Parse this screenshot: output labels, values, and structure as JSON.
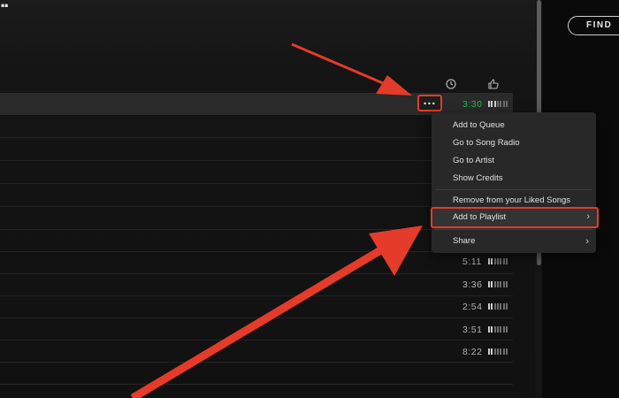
{
  "header": {
    "logo_text": "..",
    "find_button": "FIND"
  },
  "column_icons": [
    "clock-icon",
    "thumbs-up-icon"
  ],
  "tracks": [
    {
      "duration": "3:30",
      "active": true,
      "popularity": 0.4
    },
    {
      "duration": "5:11",
      "active": false,
      "popularity": 0.3
    },
    {
      "duration": "3:36",
      "active": false,
      "popularity": 0.3
    },
    {
      "duration": "2:54",
      "active": false,
      "popularity": 0.3
    },
    {
      "duration": "3:51",
      "active": false,
      "popularity": 0.3
    },
    {
      "duration": "8:22",
      "active": false,
      "popularity": 0.3
    }
  ],
  "more_button": "...",
  "context_menu": {
    "items": [
      {
        "label": "Add to Queue"
      },
      {
        "label": "Go to Song Radio"
      },
      {
        "label": "Go to Artist"
      },
      {
        "label": "Show Credits"
      },
      {
        "label": "Remove from your Liked Songs"
      },
      {
        "label": "Add to Playlist",
        "submenu": true,
        "selected": true
      },
      {
        "label": "Share",
        "submenu": true
      }
    ]
  },
  "colors": {
    "accent_green": "#1db954",
    "annotation_red": "#e53b2a",
    "menu_bg": "#282828"
  }
}
